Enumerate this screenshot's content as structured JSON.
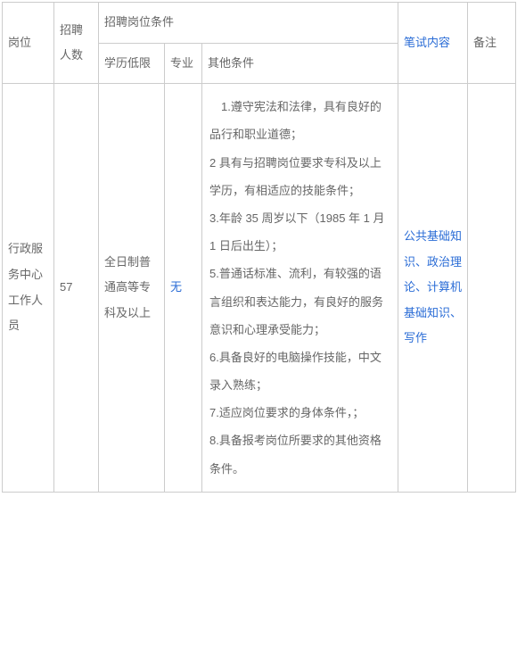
{
  "headers": {
    "position": "岗位",
    "count": "招聘人数",
    "conditions": "招聘岗位条件",
    "edu": "学历低限",
    "major": "专业",
    "other": "其他条件",
    "exam": "笔试内容",
    "remark": "备注"
  },
  "row": {
    "position": "行政服务中心工作人员",
    "count": "57",
    "edu": "全日制普通高等专科及以上",
    "major": "无",
    "other": "　1.遵守宪法和法律，具有良好的品行和职业道德；\n2 具有与招聘岗位要求专科及以上学历，有相适应的技能条件；\n3.年龄 35 周岁以下（1985 年 1 月 1 日后出生）；\n5.普通话标准、流利，有较强的语言组织和表达能力，有良好的服务意识和心理承受能力；\n6.具备良好的电脑操作技能，中文录入熟练；\n7.适应岗位要求的身体条件，；\n8.具备报考岗位所要求的其他资格条件。",
    "exam": "公共基础知识、政治理论、计算机基础知识、写作",
    "remark": ""
  }
}
